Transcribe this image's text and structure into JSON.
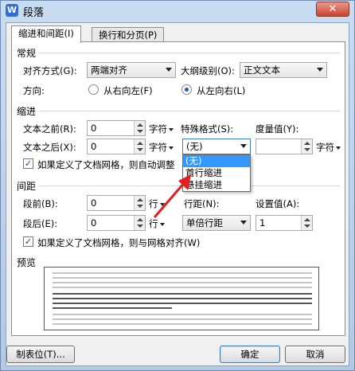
{
  "window": {
    "title": "段落",
    "app_icon": "W",
    "close": "✕"
  },
  "tabs": [
    {
      "label": "缩进和间距(I)",
      "active": true
    },
    {
      "label": "换行和分页(P)",
      "active": false
    }
  ],
  "general": {
    "title": "常规",
    "alignment_label": "对齐方式(G):",
    "alignment_value": "两端对齐",
    "outline_label": "大纲级别(O):",
    "outline_value": "正文文本",
    "direction_label": "方向:",
    "rtl_label": "从右向左(F)",
    "ltr_label": "从左向右(L)",
    "direction_selected": "ltr"
  },
  "indent": {
    "title": "缩进",
    "before_label": "文本之前(R):",
    "before_value": "0",
    "before_unit": "字符",
    "after_label": "文本之后(X):",
    "after_value": "0",
    "after_unit": "字符",
    "special_label": "特殊格式(S):",
    "special_value": "(无)",
    "measure_label": "度量值(Y):",
    "measure_value": "",
    "measure_unit": "字符",
    "grid_checkbox_label": "如果定义了文档网格，则自动调整",
    "grid_checked": true,
    "special_options": [
      "(无)",
      "首行缩进",
      "悬挂缩进"
    ],
    "special_highlight": 0
  },
  "spacing": {
    "title": "间距",
    "before_label": "段前(B):",
    "before_value": "0",
    "before_unit": "行",
    "after_label": "段后(E):",
    "after_value": "0",
    "after_unit": "行",
    "line_label": "行距(N):",
    "line_value": "单倍行距",
    "setting_label": "设置值(A):",
    "setting_value": "1",
    "grid_checkbox_label": "如果定义了文档网格，则与网格对齐(W)",
    "grid_checked": true
  },
  "preview": {
    "title": "预览"
  },
  "footer": {
    "tabs_button": "制表位(T)...",
    "ok_button": "确定",
    "cancel_button": "取消"
  },
  "colors": {
    "accent": "#3399ff",
    "arrow": "#e02020"
  }
}
